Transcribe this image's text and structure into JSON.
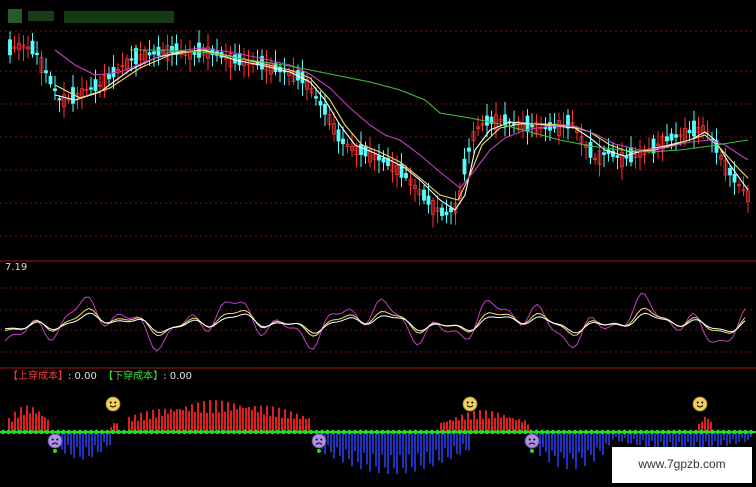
{
  "app": {
    "indicator_top_value": "7.19",
    "legend": {
      "up_label": "【上穿成本】",
      "up_value": ": 0.00",
      "down_label": "【下穿成本】",
      "down_value": ": 0.00"
    },
    "watermark": "www.7gpzb.com",
    "colors": {
      "background": "#000000",
      "up_candle": "#ff3030",
      "down_candle": "#54ffff",
      "ma_short": "#ffffff",
      "ma_mid": "#e8e070",
      "ma_long": "#c040c0",
      "ma_longest": "#40c040",
      "gridline": "#a01818",
      "zero_line": "#20e020",
      "pos_bars": "#e02020",
      "neg_bars": "#2030c0"
    },
    "icons": [
      "smiley-icon",
      "sad-face-icon"
    ]
  }
}
